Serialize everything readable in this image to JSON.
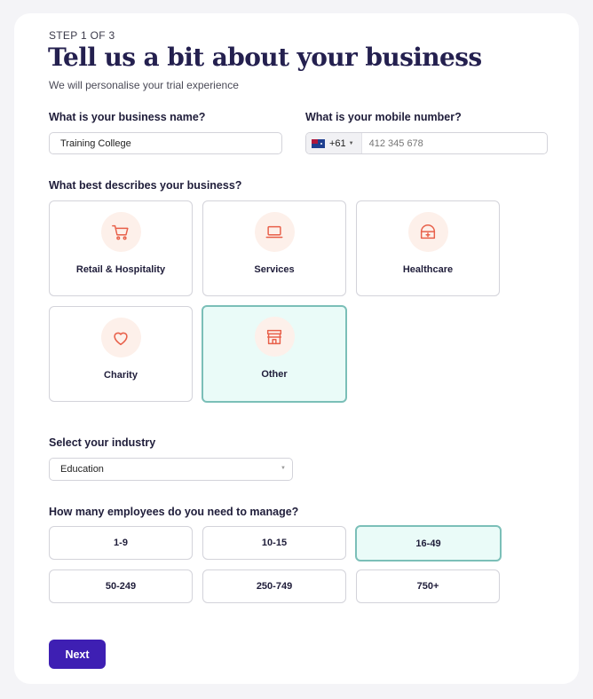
{
  "header": {
    "step": "STEP 1 OF 3",
    "title": "Tell us a bit about your business",
    "subtitle": "We will personalise your trial experience"
  },
  "business_name": {
    "label": "What is your business name?",
    "value": "Training College"
  },
  "mobile": {
    "label": "What is your mobile number?",
    "country_code": "+61",
    "placeholder": "412 345 678"
  },
  "business_type": {
    "label": "What best describes your business?",
    "options": [
      {
        "label": "Retail & Hospitality",
        "icon": "shopping-cart-icon"
      },
      {
        "label": "Services",
        "icon": "laptop-icon"
      },
      {
        "label": "Healthcare",
        "icon": "medical-kit-icon"
      },
      {
        "label": "Charity",
        "icon": "heart-icon"
      },
      {
        "label": "Other",
        "icon": "storefront-icon"
      }
    ],
    "selected": "Other"
  },
  "industry": {
    "label": "Select your industry",
    "value": "Education"
  },
  "employees": {
    "label": "How many employees do you need to manage?",
    "options": [
      "1-9",
      "10-15",
      "16-49",
      "50-249",
      "250-749",
      "750+"
    ],
    "selected": "16-49"
  },
  "actions": {
    "next_label": "Next"
  },
  "colors": {
    "accent": "#3e1fb3",
    "selected_bg": "#eafbf8",
    "selected_border": "#7bbfb8",
    "icon_color": "#e8604a",
    "icon_bg": "#fdf0ea",
    "title": "#24204f"
  }
}
